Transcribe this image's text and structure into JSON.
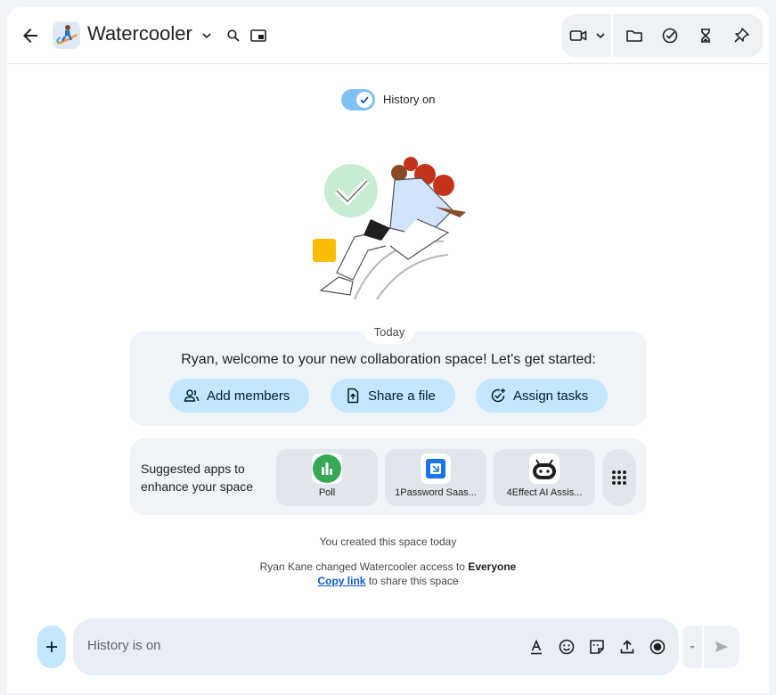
{
  "header": {
    "title": "Watercooler"
  },
  "history": {
    "label": "History on",
    "enabled": true
  },
  "timeline": {
    "date_chip": "Today"
  },
  "welcome": {
    "text": "Ryan, welcome to your new collaboration space! Let's get started:",
    "buttons": [
      {
        "label": "Add members",
        "icon": "add-members-icon"
      },
      {
        "label": "Share a file",
        "icon": "share-file-icon"
      },
      {
        "label": "Assign tasks",
        "icon": "assign-tasks-icon"
      }
    ]
  },
  "apps": {
    "label": "Suggested apps to enhance your space",
    "items": [
      {
        "name": "Poll",
        "icon": "poll-icon"
      },
      {
        "name": "1Password Saas...",
        "icon": "onepassword-icon"
      },
      {
        "name": "4Effect AI Assis...",
        "icon": "robot-icon"
      }
    ]
  },
  "system_messages": {
    "created": "You created this space today",
    "access_prefix": "Ryan Kane changed Watercooler access to",
    "access_value": "Everyone",
    "link_text": "Copy link",
    "link_suffix": "to share this space"
  },
  "composer": {
    "placeholder": "History is on"
  },
  "colors": {
    "accent_light": "#c2e7ff",
    "toggle_track": "#7fc1f5",
    "link": "#0b57d0",
    "poll_green": "#34a853",
    "onepassword_blue": "#1a73e8"
  }
}
